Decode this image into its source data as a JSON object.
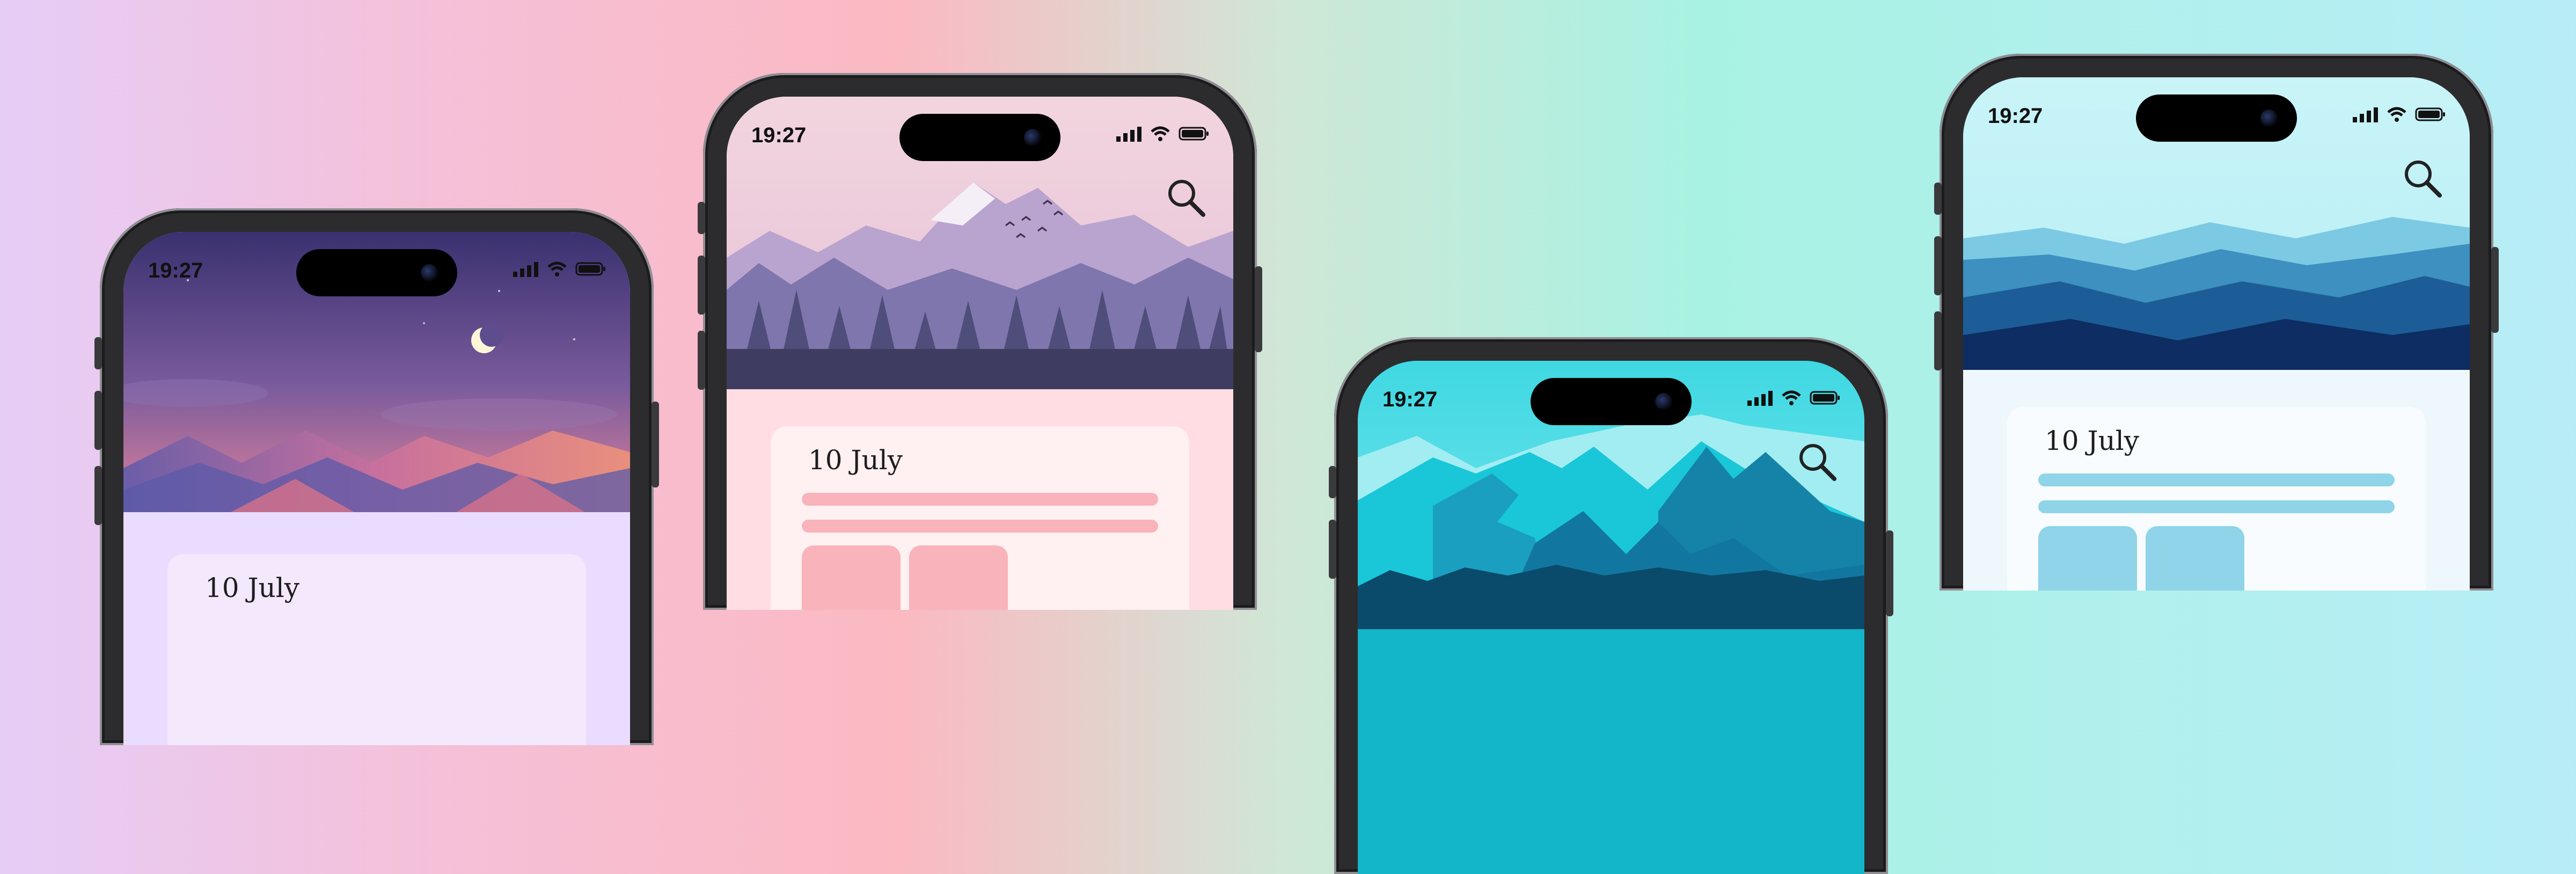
{
  "phones": [
    {
      "time": "19:27",
      "date": "10 July",
      "theme": "purple-night-dunes",
      "accent": "#b9a2e6"
    },
    {
      "time": "19:27",
      "date": "10 July",
      "theme": "pink-mountains-forest",
      "accent": "#f7a8b4"
    },
    {
      "time": "19:27",
      "theme": "teal-mountains",
      "accent": "#19c7d8"
    },
    {
      "time": "19:27",
      "date": "10 July",
      "theme": "blue-mountain-layers",
      "accent": "#8fd4e8"
    }
  ],
  "icons": [
    "search-icon",
    "signal-icon",
    "wifi-icon",
    "battery-icon",
    "moon-icon",
    "birds-icon"
  ],
  "colors": {
    "background_left": "#e6cdf7",
    "background_mid": "#fbb9c2",
    "background_right": "#b8edf7"
  }
}
